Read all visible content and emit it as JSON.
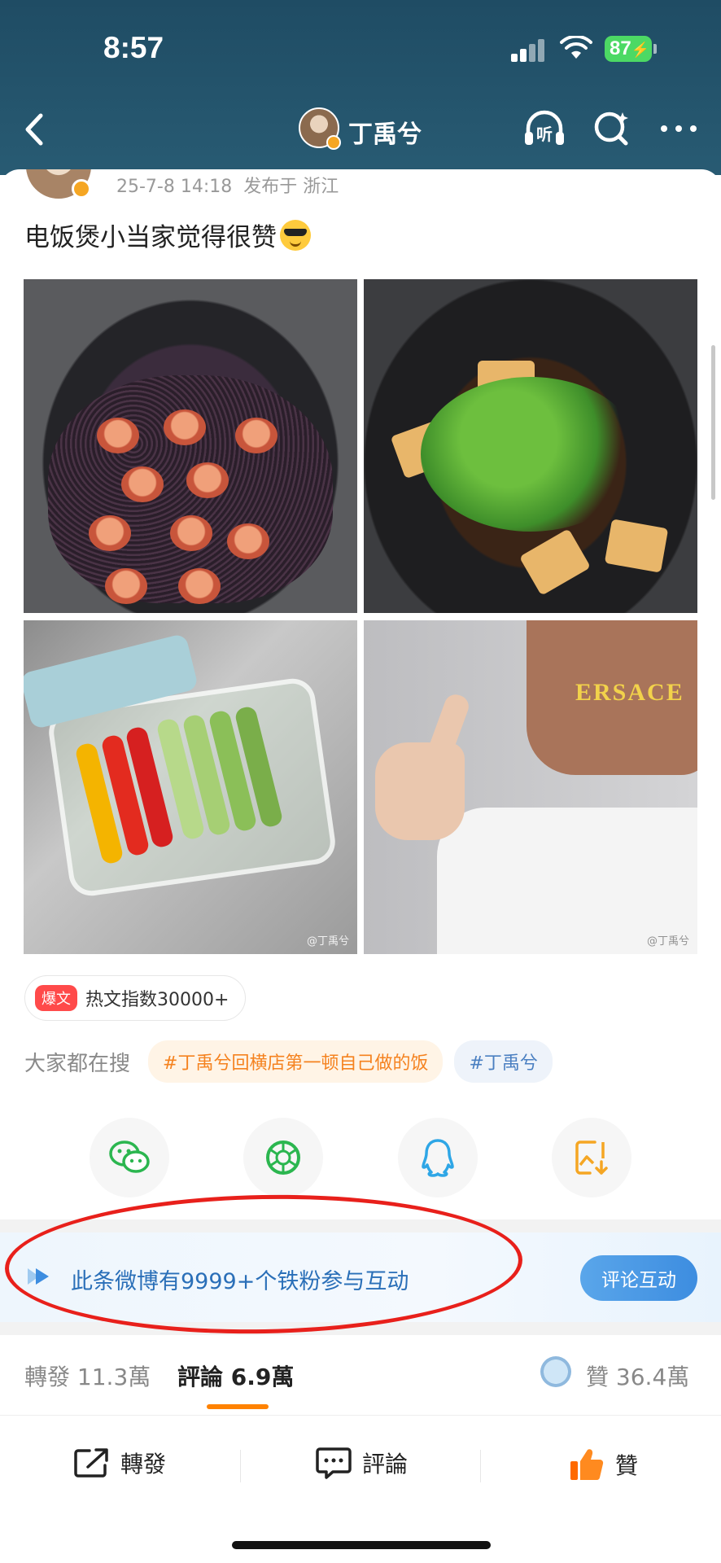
{
  "status_bar": {
    "time": "8:57",
    "battery": "87"
  },
  "nav": {
    "title": "丁禹兮"
  },
  "post": {
    "date": "25-7-8 14:18",
    "location": "发布于 浙江",
    "text": "电饭煲小当家觉得很赞",
    "emoji": "sunglasses-emoji",
    "watermarks": [
      "@丁禹兮",
      "@丁禹兮"
    ]
  },
  "hot": {
    "badge": "爆文",
    "text": "热文指数30000+"
  },
  "search": {
    "label": "大家都在搜",
    "topics": [
      "#丁禹兮回横店第一顿自己做的饭",
      "#丁禹兮"
    ]
  },
  "share_icons": [
    "wechat-icon",
    "moments-icon",
    "qq-icon",
    "save-image-icon"
  ],
  "banner": {
    "text": "此条微博有9999+个铁粉参与互动",
    "button": "评论互动"
  },
  "stats": {
    "repost_label": "轉發",
    "repost_count": "11.3萬",
    "comment_label": "評論",
    "comment_count": "6.9萬",
    "like_label": "贊",
    "like_count": "36.4萬"
  },
  "actions": {
    "repost": "轉發",
    "comment": "評論",
    "like": "贊"
  },
  "colors": {
    "header": "#285b73",
    "accent": "#ff8200",
    "annotation": "#e8201b",
    "banner_text": "#2a6fb8"
  }
}
